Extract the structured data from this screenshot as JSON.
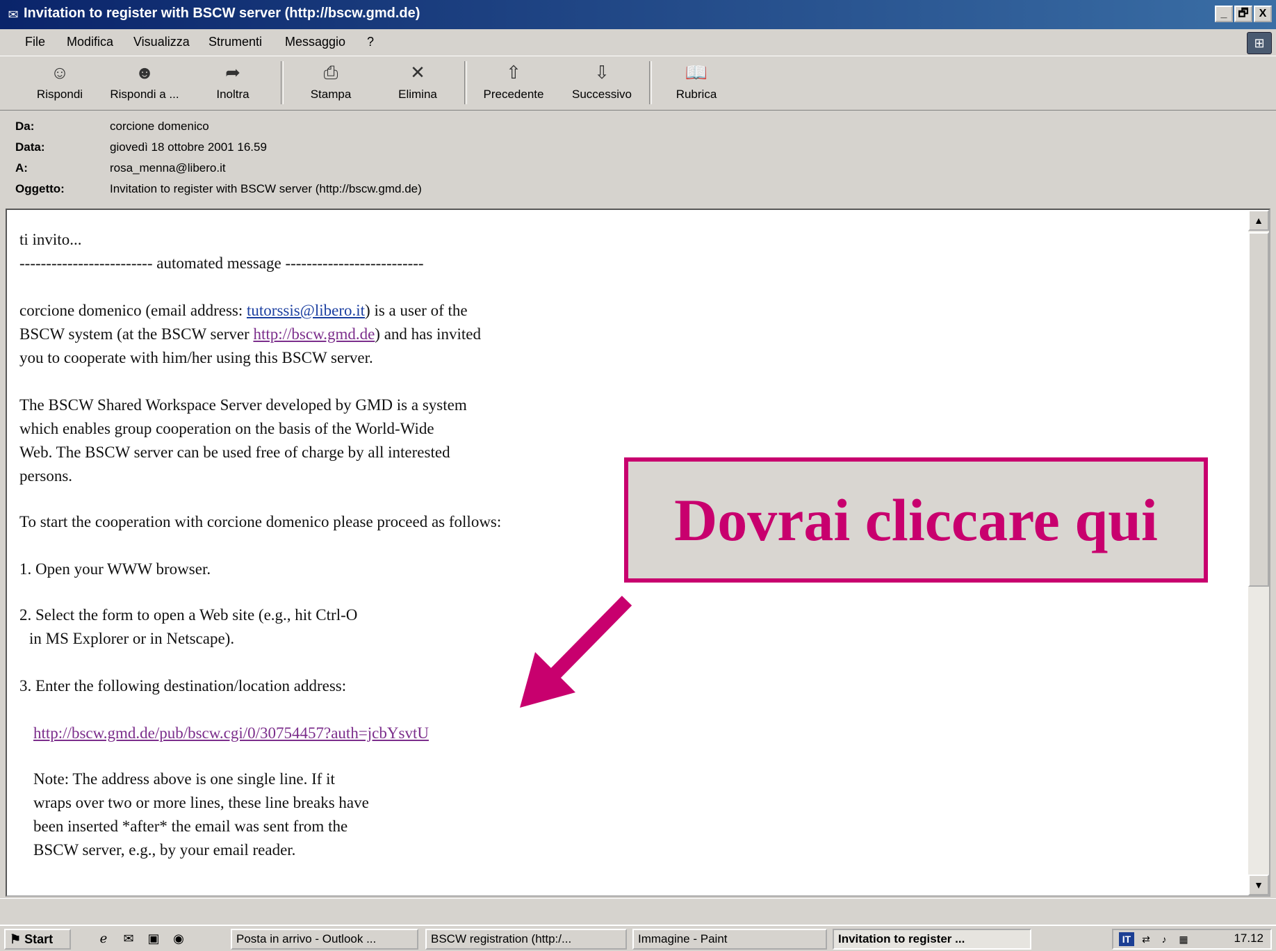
{
  "window": {
    "title": "Invitation to register with BSCW server (http://bscw.gmd.de)",
    "controls": [
      "_",
      "🗗",
      "X"
    ]
  },
  "menu": [
    "File",
    "Modifica",
    "Visualizza",
    "Strumenti",
    "Messaggio",
    "?"
  ],
  "toolbar": {
    "reply": "Rispondi",
    "reply_all": "Rispondi a ...",
    "forward": "Inoltra",
    "print": "Stampa",
    "delete": "Elimina",
    "previous": "Precedente",
    "next": "Successivo",
    "addressbook": "Rubrica"
  },
  "header": {
    "from_label": "Da:",
    "from": "corcione domenico",
    "date_label": "Data:",
    "date": "giovedì 18 ottobre 2001 16.59",
    "to_label": "A:",
    "to": "rosa_menna@libero.it",
    "subject_label": "Oggetto:",
    "subject": "Invitation to register with BSCW server (http://bscw.gmd.de)"
  },
  "message": {
    "l1": "ti invito...",
    "l2": "------------------------- automated message --------------------------",
    "l3a": "corcione domenico (email address: ",
    "l3link": "tutorssis@libero.it",
    "l3b": ") is a user of the",
    "l4a": "BSCW system (at the BSCW server ",
    "l4link": "http://bscw.gmd.de",
    "l4b": ") and has invited",
    "l5": "you to cooperate with him/her using this BSCW server.",
    "l6": "The BSCW Shared Workspace Server developed by GMD is a system",
    "l7": "which enables group cooperation on the basis of the World-Wide",
    "l8": "Web. The BSCW server can be used free of charge by all interested",
    "l9": "persons.",
    "l10": "To start the cooperation with corcione domenico please proceed as follows:",
    "l11": "1. Open your WWW browser.",
    "l12": "2. Select the form to open a Web site (e.g., hit Ctrl-O",
    "l13": "in MS Explorer or in Netscape).",
    "l14": "3. Enter the following destination/location address:",
    "l15link": "http://bscw.gmd.de/pub/bscw.cgi/0/30754457?auth=jcbYsvtU",
    "l16": "Note: The address above is one single line. If it",
    "l17": "wraps over two or more lines, these line breaks have",
    "l18": "been inserted *after* the email was sent from the",
    "l19": "BSCW server, e.g., by your email reader."
  },
  "callout": {
    "text": "Dovrai cliccare qui",
    "color": "#c8006e"
  },
  "taskbar": {
    "start": "Start",
    "tasks": [
      "Posta in arrivo - Outlook ...",
      "BSCW registration (http:/...",
      "Immagine - Paint",
      "Invitation to register ..."
    ],
    "tray_lang": "IT",
    "clock": "17.12"
  }
}
